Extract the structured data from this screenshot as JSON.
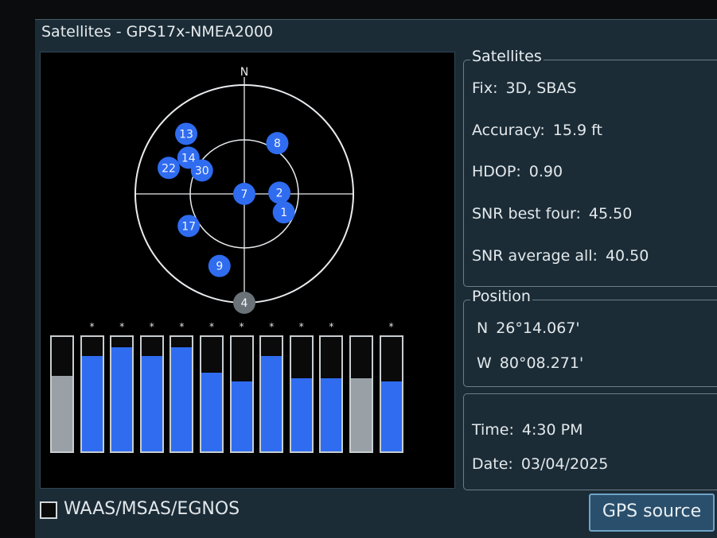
{
  "window": {
    "title": "Satellites - GPS17x-NMEA2000"
  },
  "skyplot": {
    "north_label": "N",
    "satellites": [
      {
        "id": "13",
        "az": 316,
        "el": 21,
        "color": "#2f6cf0"
      },
      {
        "id": "14",
        "az": 303,
        "el": 35,
        "color": "#2f6cf0"
      },
      {
        "id": "22",
        "az": 289,
        "el": 24,
        "color": "#2f6cf0"
      },
      {
        "id": "30",
        "az": 299,
        "el": 50,
        "color": "#2f6cf0"
      },
      {
        "id": "8",
        "az": 33,
        "el": 40,
        "color": "#2f6cf0"
      },
      {
        "id": "7",
        "az": 0,
        "el": 90,
        "color": "#2f6cf0"
      },
      {
        "id": "2",
        "az": 88,
        "el": 61,
        "color": "#2f6cf0"
      },
      {
        "id": "1",
        "az": 115,
        "el": 54,
        "color": "#2f6cf0"
      },
      {
        "id": "17",
        "az": 240,
        "el": 37,
        "color": "#2f6cf0"
      },
      {
        "id": "9",
        "az": 199,
        "el": 27,
        "color": "#2f6cf0"
      },
      {
        "id": "4",
        "az": 180,
        "el": 0,
        "color": "#6a7278"
      }
    ]
  },
  "signal_bars": [
    {
      "level": 0.66,
      "color": "#9aa1a6",
      "in_use": false
    },
    {
      "level": 0.83,
      "color": "#2f6cf0",
      "in_use": true
    },
    {
      "level": 0.91,
      "color": "#2f6cf0",
      "in_use": true
    },
    {
      "level": 0.83,
      "color": "#2f6cf0",
      "in_use": true
    },
    {
      "level": 0.91,
      "color": "#2f6cf0",
      "in_use": true
    },
    {
      "level": 0.69,
      "color": "#2f6cf0",
      "in_use": true
    },
    {
      "level": 0.61,
      "color": "#2f6cf0",
      "in_use": true
    },
    {
      "level": 0.83,
      "color": "#2f6cf0",
      "in_use": true
    },
    {
      "level": 0.64,
      "color": "#2f6cf0",
      "in_use": true
    },
    {
      "level": 0.64,
      "color": "#2f6cf0",
      "in_use": true
    },
    {
      "level": 0.64,
      "color": "#9aa1a6",
      "in_use": false
    },
    {
      "level": 0.61,
      "color": "#2f6cf0",
      "in_use": true
    }
  ],
  "in_use_marker": "*",
  "satellites_panel": {
    "legend": "Satellites",
    "fix_label": "Fix:",
    "fix_value": "3D, SBAS",
    "accuracy_label": "Accuracy:",
    "accuracy_value": "15.9 ft",
    "hdop_label": "HDOP:",
    "hdop_value": "0.90",
    "snr_best_label": "SNR best four:",
    "snr_best_value": "45.50",
    "snr_avg_label": "SNR average all:",
    "snr_avg_value": "40.50"
  },
  "position_panel": {
    "legend": "Position",
    "lat_hemi": "N",
    "lat_value": "26°14.067'",
    "lon_hemi": "W",
    "lon_value": "80°08.271'"
  },
  "time_panel": {
    "time_label": "Time:",
    "time_value": "4:30 PM",
    "date_label": "Date:",
    "date_value": "03/04/2025"
  },
  "waas": {
    "label": "WAAS/MSAS/EGNOS",
    "checked": false
  },
  "gps_source_button": "GPS source"
}
